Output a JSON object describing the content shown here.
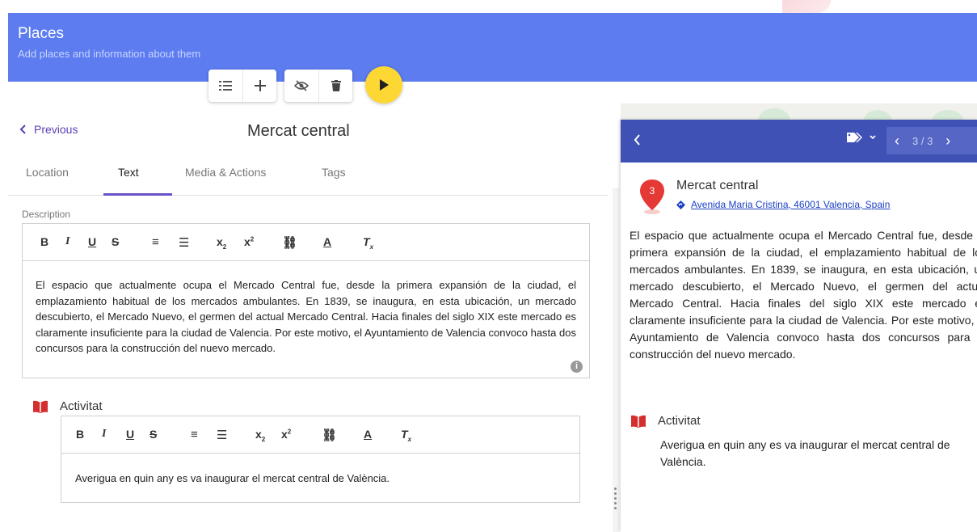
{
  "header": {
    "title": "Places",
    "subtitle": "Add places and information about them"
  },
  "toolbar": {
    "icons": [
      "list-icon",
      "add-icon",
      "hide-icon",
      "delete-icon",
      "play-icon"
    ],
    "play_color": "#fdd835"
  },
  "editor_panel": {
    "previous_label": "Previous",
    "place_title": "Mercat central",
    "tabs": [
      {
        "label": "Location"
      },
      {
        "label": "Text"
      },
      {
        "label": "Media & Actions"
      },
      {
        "label": "Tags"
      }
    ],
    "active_tab": "Text",
    "description_label": "Description",
    "description_text": "El espacio que actualmente ocupa el Mercado Central fue, desde la primera expansión de la ciudad, el emplazamiento habitual de los mercados ambulantes. En 1839, se inaugura, en esta ubicación, un mercado descubierto, el Mercado Nuevo, el germen del actual Mercado Central. Hacia finales del siglo XIX este mercado es claramente insuficiente para la ciudad de Valencia. Por este motivo, el Ayuntamiento de Valencia convoco hasta dos concursos para la construcción del nuevo mercado.",
    "format_tools": [
      "B",
      "I",
      "U",
      "S",
      "ordered-list",
      "bullet-list",
      "subscript",
      "superscript",
      "link",
      "text-color",
      "clear-format"
    ],
    "activity_label": "Activitat",
    "activity_text": "Averigua en quin any es va inaugurar el mercat central de València."
  },
  "preview_panel": {
    "pager": "3 / 3",
    "marker_number": "3",
    "place_name": "Mercat central",
    "address": "Avenida Maria Cristina, 46001 Valencia, Spain",
    "description_text": "El espacio que actualmente ocupa el Mercado Central fue, desde la primera expansión de la ciudad, el emplazamiento habitual de los mercados ambulantes. En 1839, se inaugura, en esta ubicación, un mercado descubierto, el Mercado Nuevo, el germen del actual Mercado Central. Hacia finales del siglo XIX este mercado es claramente insuficiente para la ciudad de Valencia. Por este motivo, el Ayuntamiento de Valencia convoco hasta dos concursos para la construcción del nuevo mercado.",
    "activity_label": "Activitat",
    "activity_text": "Averigua en quin any es va inaugurar el mercat central de València."
  },
  "colors": {
    "header": "#5c7cf0",
    "preview_bar": "#3f51b5",
    "accent": "#6a52c8",
    "marker": "#e53935",
    "book_icon": "#d32f2f"
  }
}
